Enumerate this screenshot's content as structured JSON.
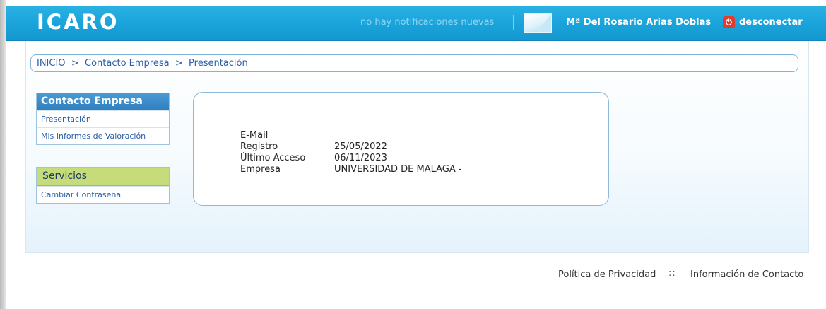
{
  "header": {
    "logo": "ICARO",
    "notifications": "no hay notificaciones nuevas",
    "user_name": "Mª Del Rosario Arias Doblas",
    "logout_label": "desconectar",
    "power_glyph": "⏻",
    "brand_color": "#19a3da"
  },
  "breadcrumb": {
    "items": [
      "INICIO",
      "Contacto Empresa",
      "Presentación"
    ],
    "separator": ">"
  },
  "sidebar": {
    "contact_section": {
      "title": "Contacto Empresa",
      "items": [
        {
          "label": "Presentación"
        },
        {
          "label": "Mis Informes de Valoración"
        }
      ]
    },
    "services_section": {
      "title": "Servicios",
      "items": [
        {
          "label": "Cambiar Contraseña"
        }
      ]
    }
  },
  "profile": {
    "rows": [
      {
        "label": "E-Mail",
        "value": ""
      },
      {
        "label": "Registro",
        "value": "25/05/2022"
      },
      {
        "label": "Último Acceso",
        "value": "06/11/2023"
      },
      {
        "label": "Empresa",
        "value": "UNIVERSIDAD DE MALAGA -"
      }
    ]
  },
  "footer": {
    "privacy": "Política de Privacidad",
    "separator": "::",
    "contact": "Información de Contacto"
  }
}
